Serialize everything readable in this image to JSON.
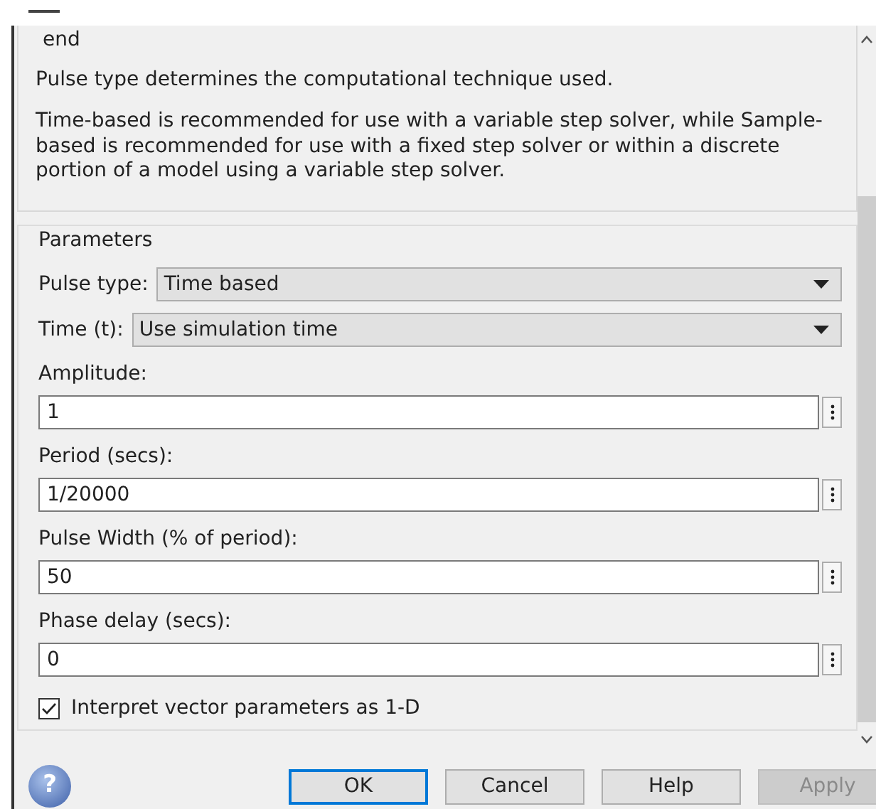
{
  "description": {
    "code_tail": "end",
    "paragraphs": [
      "Pulse type determines the computational technique used.",
      "Time-based is recommended for use with a variable step solver, while Sample-based is recommended for use with a fixed step solver or within a discrete portion of a model using a variable step solver."
    ]
  },
  "parameters": {
    "title": "Parameters",
    "fields": [
      {
        "kind": "select",
        "label": "Pulse type:",
        "value": "Time based"
      },
      {
        "kind": "select",
        "label": "Time (t):",
        "value": "Use simulation time"
      },
      {
        "kind": "text",
        "label": "Amplitude:",
        "value": "1"
      },
      {
        "kind": "text",
        "label": "Period (secs):",
        "value": "1/20000"
      },
      {
        "kind": "text",
        "label": "Pulse Width (% of period):",
        "value": "50"
      },
      {
        "kind": "text",
        "label": "Phase delay (secs):",
        "value": "0"
      },
      {
        "kind": "checkbox",
        "label": "Interpret vector parameters as 1-D",
        "checked": true
      }
    ]
  },
  "help_icon": "?",
  "buttons": [
    {
      "label": "OK",
      "default": true,
      "disabled": false
    },
    {
      "label": "Cancel",
      "default": false,
      "disabled": false
    },
    {
      "label": "Help",
      "default": false,
      "disabled": false
    },
    {
      "label": "Apply",
      "default": false,
      "disabled": true
    }
  ]
}
